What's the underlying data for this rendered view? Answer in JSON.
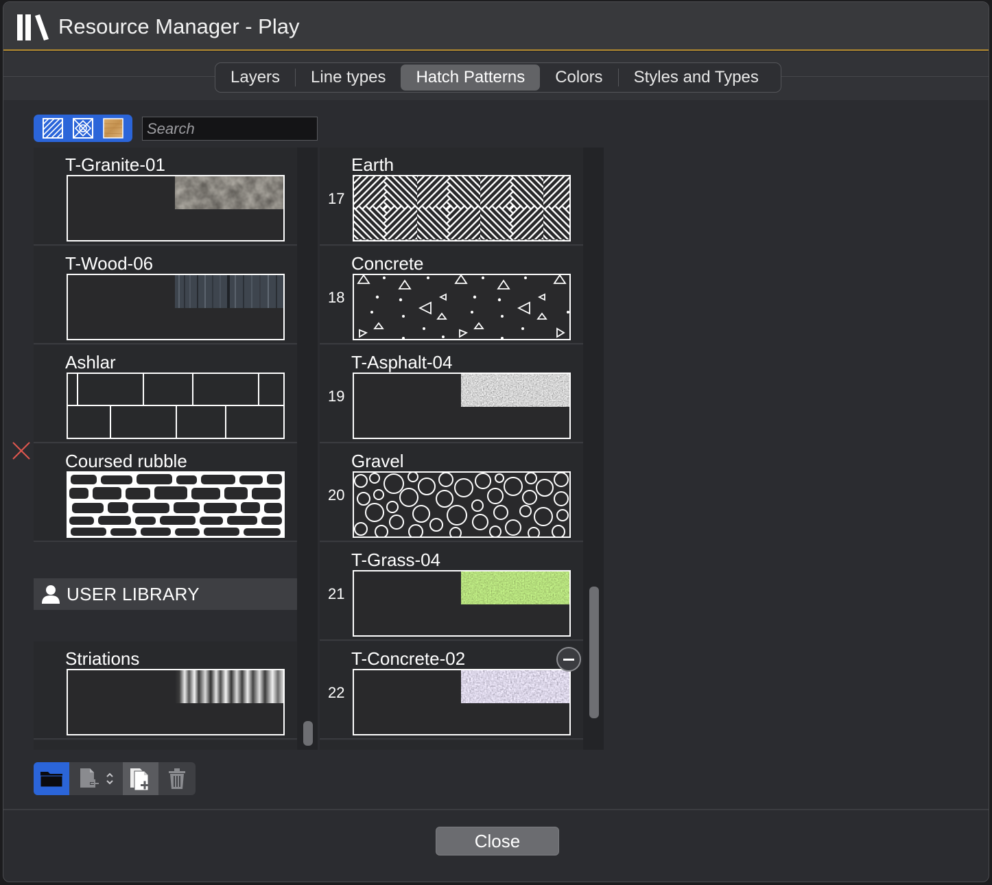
{
  "window": {
    "title": "Resource Manager - Play"
  },
  "tabs": [
    {
      "label": "Layers",
      "active": false
    },
    {
      "label": "Line types",
      "active": false
    },
    {
      "label": "Hatch Patterns",
      "active": true
    },
    {
      "label": "Colors",
      "active": false
    },
    {
      "label": "Styles and Types",
      "active": false
    }
  ],
  "filter": {
    "options": [
      "hatch-pattern-icon",
      "crosshatch-pattern-icon",
      "texture-image-icon"
    ],
    "selected": "hatch-pattern-icon"
  },
  "search": {
    "placeholder": "Search",
    "value": ""
  },
  "left_list": {
    "items": [
      {
        "name": "T-Granite-01",
        "preview": "texture"
      },
      {
        "name": "T-Wood-06",
        "preview": "texture"
      },
      {
        "name": "Ashlar",
        "preview": "ashlar"
      },
      {
        "name": "Coursed rubble",
        "preview": "rubble"
      }
    ],
    "section_header": "USER LIBRARY",
    "user_items": [
      {
        "name": "Striations",
        "preview": "texture"
      }
    ]
  },
  "right_list": {
    "items": [
      {
        "number": "17",
        "name": "Earth",
        "preview": "earth"
      },
      {
        "number": "18",
        "name": "Concrete",
        "preview": "concrete"
      },
      {
        "number": "19",
        "name": "T-Asphalt-04",
        "preview": "texture"
      },
      {
        "number": "20",
        "name": "Gravel",
        "preview": "gravel"
      },
      {
        "number": "21",
        "name": "T-Grass-04",
        "preview": "texture"
      },
      {
        "number": "22",
        "name": "T-Concrete-02",
        "preview": "texture"
      }
    ]
  },
  "colors": {
    "accent": "#2b65d9",
    "title_underline": "#b38a2e",
    "close_mark": "#e0574f",
    "grass": "#5a7a2e",
    "wood": "#c99a5b"
  },
  "toolbar": {
    "icons": [
      "folder-icon",
      "new-item-icon",
      "chevron-updown-icon",
      "duplicate-icon",
      "trash-icon"
    ]
  },
  "footer": {
    "close_label": "Close"
  }
}
